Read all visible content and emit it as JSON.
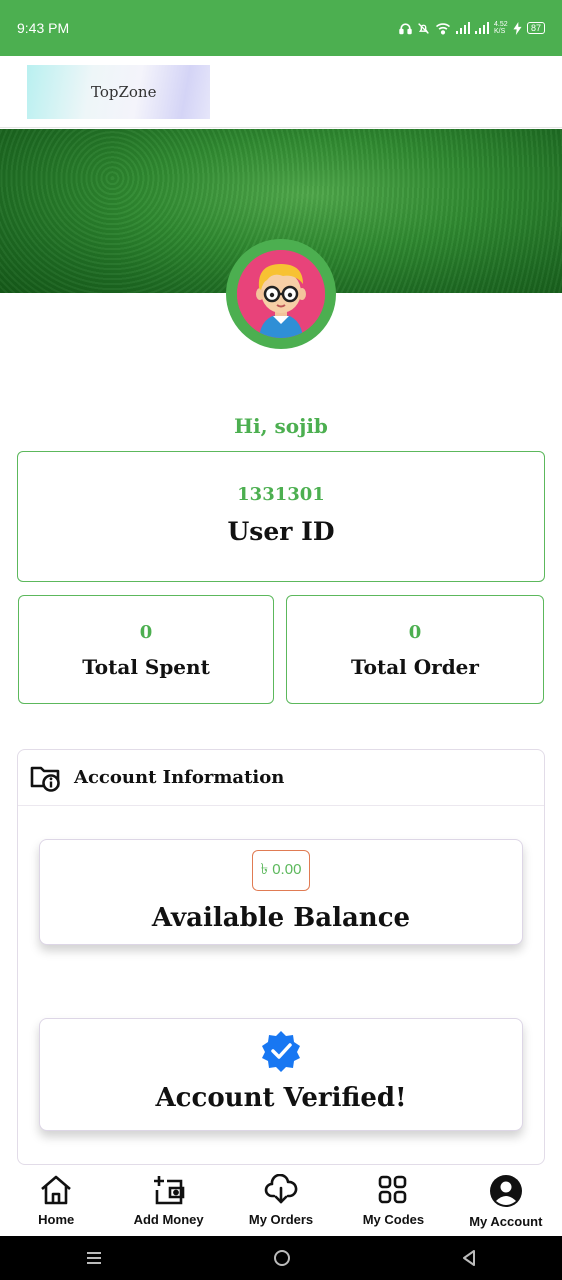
{
  "status_bar": {
    "time": "9:43 PM",
    "network_speed": "4.52 K/S",
    "battery": "87"
  },
  "header": {
    "logo_text": "TopZone"
  },
  "profile": {
    "greeting": "Hi, sojib"
  },
  "user_id_card": {
    "value": "1331301",
    "label": "User ID"
  },
  "stats": {
    "total_spent": {
      "value": "0",
      "label": "Total Spent"
    },
    "total_order": {
      "value": "0",
      "label": "Total Order"
    }
  },
  "account_info": {
    "title": "Account Information",
    "balance": {
      "amount": "৳ 0.00",
      "label": "Available Balance"
    },
    "verified": {
      "label": "Account Verified!"
    }
  },
  "bottom_nav": {
    "home": "Home",
    "add_money": "Add Money",
    "my_orders": "My Orders",
    "my_codes": "My Codes",
    "my_account": "My Account"
  },
  "colors": {
    "primary": "#4caf50",
    "badge_border": "#e07b53",
    "verified_blue": "#1877f2"
  }
}
